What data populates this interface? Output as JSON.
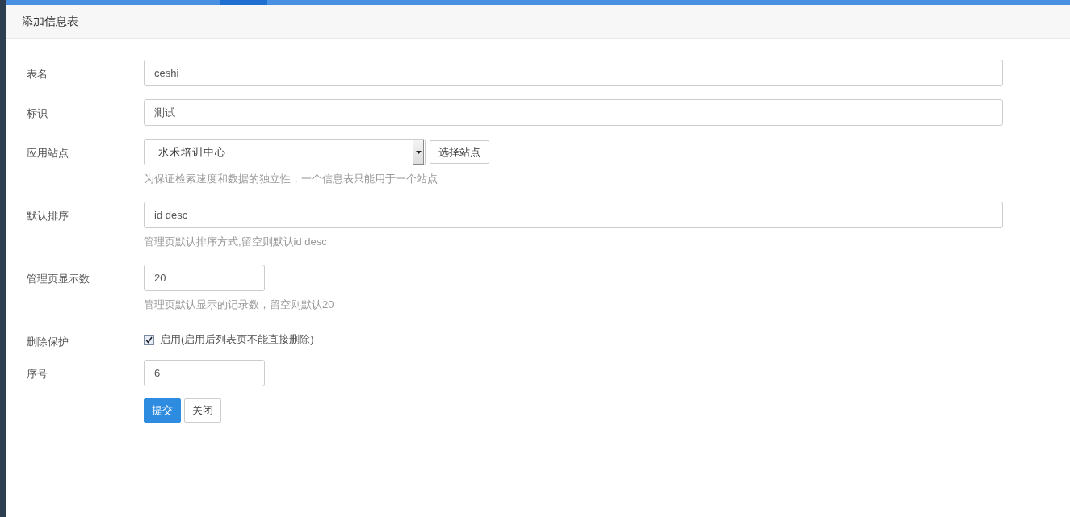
{
  "panel": {
    "title": "添加信息表"
  },
  "fields": [
    {
      "kind": "text",
      "label": "表名",
      "value": "ceshi"
    },
    {
      "kind": "text",
      "label": "标识",
      "value": "测试"
    },
    {
      "kind": "select",
      "label": "应用站点",
      "value": "水禾培训中心",
      "button": "选择站点",
      "hint": "为保证检索速度和数据的独立性，一个信息表只能用于一个站点"
    },
    {
      "kind": "text",
      "label": "默认排序",
      "value": "id desc",
      "hint": "管理页默认排序方式,留空则默认id desc"
    },
    {
      "kind": "number",
      "label": "管理页显示数",
      "value": "20",
      "hint": "管理页默认显示的记录数，留空则默认20"
    },
    {
      "kind": "checkbox",
      "label": "删除保护",
      "text": "启用(启用后列表页不能直接删除)",
      "checked": true
    },
    {
      "kind": "number",
      "label": "序号",
      "value": "6"
    }
  ],
  "buttons": [
    {
      "label": "提交",
      "kind": "primary"
    },
    {
      "label": "关闭",
      "kind": "default"
    }
  ]
}
